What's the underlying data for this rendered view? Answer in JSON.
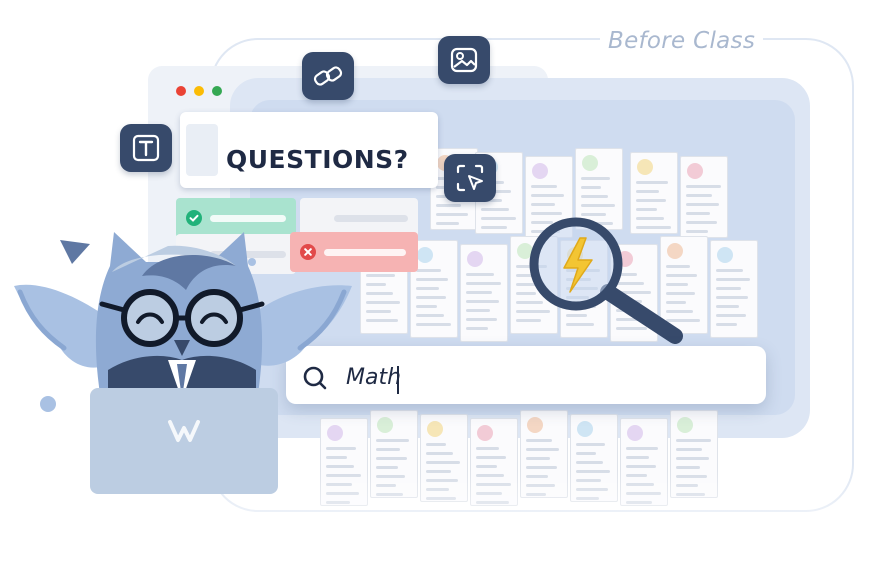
{
  "frame": {
    "label": "Before Class"
  },
  "window": {
    "dots": [
      "#ea4335",
      "#fbbc05",
      "#34a853"
    ]
  },
  "tools": {
    "icons": [
      "text-tool-icon",
      "link-tool-icon",
      "image-tool-icon",
      "select-tool-icon"
    ]
  },
  "question_card": {
    "title": "QUESTIONS?"
  },
  "answers": {
    "correct_color": "#a9e3cf",
    "wrong_color": "#f6b3b3"
  },
  "search": {
    "value": "Math",
    "icon": "search-icon"
  },
  "magnifier": {
    "icon": "lightning-icon"
  },
  "mascot": {
    "name": "owl-mascot",
    "laptop_logo": "W"
  },
  "colors": {
    "dark": "#374a6b",
    "accent": "#a9c1e3",
    "text": "#1f2a44"
  }
}
